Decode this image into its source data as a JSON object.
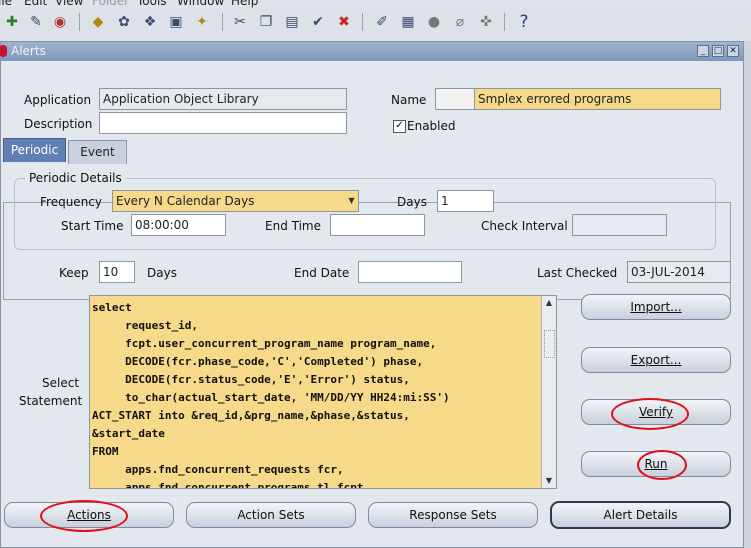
{
  "menu": [
    "ile",
    "Edit",
    "View",
    "Folder",
    "Tools",
    "Window",
    "Help"
  ],
  "toolbar_icons": [
    "new-icon",
    "flashlight-icon",
    "navigator-icon",
    "save-icon",
    "print-icon",
    "close-form-icon",
    "translate-icon",
    "attachment-icon",
    "cut-icon",
    "copy-icon",
    "paste-icon",
    "new-record-icon",
    "delete-record-icon",
    "edit-icon",
    "zoom-icon",
    "refresh-icon",
    "attach-icon",
    "folder-tools-icon",
    "help-icon"
  ],
  "window": {
    "title": "Alerts"
  },
  "fields": {
    "application": {
      "label": "Application",
      "value": "Application Object Library"
    },
    "description": {
      "label": "Description",
      "value": ""
    },
    "name": {
      "label": "Name",
      "value": "Smplex errored programs"
    },
    "enabled": {
      "label": "Enabled",
      "checked": true
    }
  },
  "tabs": {
    "periodic": "Periodic",
    "event": "Event"
  },
  "periodic": {
    "group_title": "Periodic Details",
    "frequency_label": "Frequency",
    "frequency_value": "Every N Calendar Days",
    "days_label": "Days",
    "days_value": "1",
    "start_time_label": "Start Time",
    "start_time_value": "08:00:00",
    "end_time_label": "End Time",
    "end_time_value": "",
    "check_interval_label": "Check Interval",
    "check_interval_value": ""
  },
  "keep": {
    "label": "Keep",
    "value": "10",
    "unit": "Days"
  },
  "end_date": {
    "label": "End Date",
    "value": ""
  },
  "last_checked": {
    "label": "Last Checked",
    "value": "03-JUL-2014"
  },
  "statement": {
    "label_line1": "Select",
    "label_line2": "Statement",
    "text": "select\n     request_id,\n     fcpt.user_concurrent_program_name program_name,\n     DECODE(fcr.phase_code,'C','Completed') phase,\n     DECODE(fcr.status_code,'E','Error') status,\n     to_char(actual_start_date, 'MM/DD/YY HH24:mi:SS')\nACT_START into &req_id,&prg_name,&phase,&status,\n&start_date\nFROM\n     apps.fnd_concurrent_requests fcr,\n     apps.fnd_concurrent_programs_tl fcpt"
  },
  "side_buttons": {
    "import": "Import...",
    "export": "Export...",
    "verify": "Verify",
    "run": "Run"
  },
  "bottom_buttons": {
    "actions": "Actions",
    "action_sets": "Action Sets",
    "response_sets": "Response Sets",
    "alert_details": "Alert Details"
  }
}
